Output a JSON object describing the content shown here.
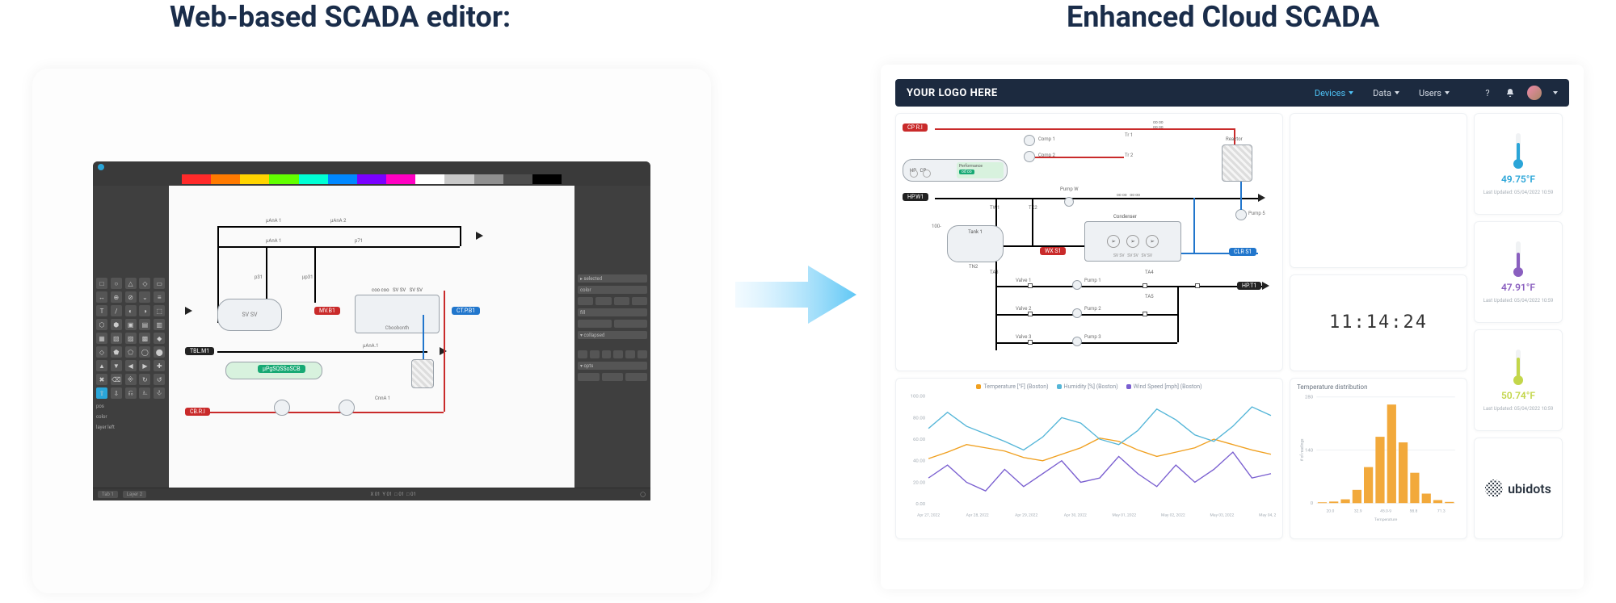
{
  "headings": {
    "left": "Web-based SCADA editor:",
    "right": "Enhanced Cloud SCADA"
  },
  "editor": {
    "color_row": [
      "#ff2a2a",
      "#ff7a00",
      "#ffd400",
      "#62ff00",
      "#00ffd5",
      "#0088ff",
      "#7a00ff",
      "#ff00c3",
      "#ffffff",
      "#c8c8c8",
      "#8f8f8f",
      "#4d4d4d",
      "#000000"
    ],
    "bottom_tabs": [
      "Tab 1",
      "Layer 2"
    ],
    "tool_cells": 45,
    "small_labels": [
      "pos",
      "color",
      "layer left"
    ],
    "canvas_tags": {
      "red": "MV.B1",
      "black": "TBL.M1",
      "blue": "CT.P.B1",
      "red2": "CB.R.I",
      "green": "µPgSQSSoSCB"
    }
  },
  "dashboard": {
    "logo": "YOUR LOGO HERE",
    "menu": [
      {
        "label": "Devices",
        "active": true
      },
      {
        "label": "Data",
        "active": false
      },
      {
        "label": "Users",
        "active": false
      }
    ],
    "clock": "11:14:24",
    "temps": [
      {
        "value": "49.75°F",
        "color": "#2aa5d8",
        "fill_h": 22,
        "updated": "Last Updated: 05/04/2022 10:59"
      },
      {
        "value": "47.91°F",
        "color": "#8a5fbf",
        "fill_h": 20,
        "updated": "Last Updated: 05/04/2022 10:59"
      },
      {
        "value": "50.74°F",
        "color": "#c3d64a",
        "fill_h": 24,
        "updated": "Last Updated: 05/04/2022 10:59"
      }
    ],
    "brand": "ubidots",
    "scada": {
      "tags": {
        "cp_ri": "CP R.I",
        "hp_w1": "HP.W1",
        "wx_s1": "WX S1",
        "clr_s1": "CLR S1",
        "hp_t1": "HP.T1"
      },
      "labels": {
        "comp1": "Comp 1",
        "comp2": "Comp 2",
        "tr1": "Tr 1",
        "tr2": "Tr 2",
        "reactor": "Reactor",
        "hp": "HP",
        "cp": "CP",
        "performance": "Performance",
        "pump_w": "Pump W",
        "tw1": "TW1",
        "tk2": "TK2",
        "condenser": "Condenser",
        "pump5": "Pump 5",
        "tank1": "Tank 1",
        "t100": "100-",
        "tn2": "TN2",
        "ta3": "TA3",
        "ta4": "TA4",
        "ta5": "TA5",
        "valve1": "Valve 1",
        "valve2": "Valve 2",
        "valve3": "Valve 3",
        "pump1": "Pump 1",
        "pump2": "Pump 2",
        "pump3": "Pump 3"
      }
    }
  },
  "chart_data": [
    {
      "type": "line",
      "title": "",
      "xlabel": "",
      "ylabel": "",
      "ylim_left": [
        0,
        100
      ],
      "ylim_right": [
        0,
        25
      ],
      "y_ticks_left": [
        "100.00",
        "80.00",
        "60.00",
        "40.00",
        "20.00",
        "0.00"
      ],
      "x_ticks": [
        "Apr 27, 2022",
        "Apr 28, 2022",
        "Apr 29, 2022",
        "Apr 30, 2022",
        "May 01, 2022",
        "May 02, 2022",
        "May 03, 2022",
        "May 04, 2022"
      ],
      "legend": [
        {
          "name": "Temperature [°F] (Boston)",
          "color": "#f0a020"
        },
        {
          "name": "Humidity [%] (Boston)",
          "color": "#55b6d8"
        },
        {
          "name": "Wind Speed [mph] (Boston)",
          "color": "#7a5fd0"
        }
      ],
      "series": [
        {
          "name": "Temperature",
          "color": "#f0a020",
          "values": [
            42,
            48,
            55,
            52,
            49,
            43,
            40,
            46,
            52,
            61,
            58,
            50,
            44,
            48,
            52,
            60,
            55,
            50,
            46
          ]
        },
        {
          "name": "Humidity",
          "color": "#55b6d8",
          "values": [
            70,
            85,
            72,
            65,
            58,
            50,
            62,
            80,
            75,
            60,
            55,
            68,
            88,
            78,
            64,
            58,
            72,
            90,
            82
          ]
        },
        {
          "name": "Wind",
          "color": "#7a5fd0",
          "scale": "right",
          "values": [
            6,
            9,
            5,
            3,
            8,
            4,
            7,
            10,
            5,
            6,
            11,
            7,
            4,
            9,
            5,
            8,
            12,
            6,
            7
          ]
        }
      ]
    },
    {
      "type": "bar",
      "title": "Temperature distribution",
      "xlabel": "Temperature",
      "ylabel": "# of readings",
      "categories": [
        "20.0",
        "32.9",
        "45.0-9",
        "58.8",
        "71.3"
      ],
      "values": [
        2,
        4,
        10,
        35,
        95,
        175,
        260,
        160,
        80,
        25,
        8,
        3
      ],
      "ylim": [
        0,
        280
      ],
      "y_ticks": [
        "280",
        "140",
        "0"
      ],
      "color": "#f2a93b"
    }
  ]
}
